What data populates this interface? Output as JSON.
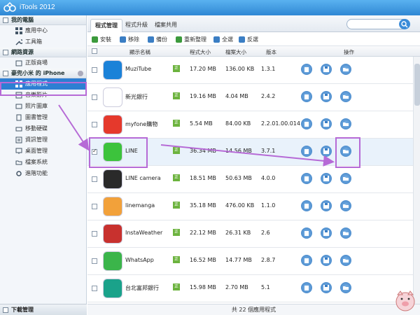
{
  "window": {
    "title": "iTools 2012"
  },
  "sidebar": {
    "sections": [
      {
        "label": "我的電腦",
        "items": [
          "應用中心",
          "工具箱"
        ]
      },
      {
        "label": "網路資源",
        "items": [
          "正版商場"
        ]
      },
      {
        "label": "豪兜小米 的 iPhone",
        "items": [
          "應用程式",
          "音樂影片",
          "照片圖庫",
          "圖書管理",
          "移動硬碟",
          "資訊管理",
          "桌面管理",
          "檔案系統",
          "進階功能"
        ]
      }
    ],
    "active_item": "應用程式",
    "download_label": "下載管理"
  },
  "tabs": [
    "程式管理",
    "程式升級",
    "檔案共用"
  ],
  "search": {
    "placeholder": ""
  },
  "toolbar": [
    "安裝",
    "移除",
    "備份",
    "重新整理",
    "全選",
    "反選"
  ],
  "table": {
    "columns": [
      "顯示名稱",
      "程式大小",
      "檔案大小",
      "版本",
      "操作"
    ],
    "rows": [
      {
        "name": "MuziTube",
        "format": "正",
        "app_size": "17.20 MB",
        "doc_size": "136.00 KB",
        "version": "1.3.1",
        "checked": false,
        "icon": "muzitube-icon",
        "icon_color": "#1b82d8"
      },
      {
        "name": "新光銀行",
        "format": "正",
        "app_size": "19.16 MB",
        "doc_size": "4.04 MB",
        "version": "2.4.2",
        "checked": false,
        "icon": "skbank-icon",
        "icon_color": "#ffffff"
      },
      {
        "name": "myfone購物",
        "format": "正",
        "app_size": "5.54 MB",
        "doc_size": "84.00 KB",
        "version": "2.2.01.00.014",
        "checked": false,
        "icon": "myfone-icon",
        "icon_color": "#e5392c"
      },
      {
        "name": "LINE",
        "format": "正",
        "app_size": "36.34 MB",
        "doc_size": "14.56 MB",
        "version": "3.7.1",
        "checked": true,
        "icon": "line-icon",
        "icon_color": "#3cc33c"
      },
      {
        "name": "LINE camera",
        "format": "正",
        "app_size": "18.51 MB",
        "doc_size": "50.63 MB",
        "version": "4.0.0",
        "checked": false,
        "icon": "line-camera-icon",
        "icon_color": "#2a2a2a"
      },
      {
        "name": "linemanga",
        "format": "正",
        "app_size": "35.18 MB",
        "doc_size": "476.00 KB",
        "version": "1.1.0",
        "checked": false,
        "icon": "linemanga-icon",
        "icon_color": "#f2a13a"
      },
      {
        "name": "InstaWeather",
        "format": "正",
        "app_size": "22.12 MB",
        "doc_size": "26.31 KB",
        "version": "2.6",
        "checked": false,
        "icon": "instaweather-icon",
        "icon_color": "#c8312e"
      },
      {
        "name": "WhatsApp",
        "format": "正",
        "app_size": "16.52 MB",
        "doc_size": "14.77 MB",
        "version": "2.8.7",
        "checked": false,
        "icon": "whatsapp-icon",
        "icon_color": "#3bb54a"
      },
      {
        "name": "台北富邦銀行",
        "format": "正",
        "app_size": "15.98 MB",
        "doc_size": "2.70 MB",
        "version": "5.1",
        "checked": false,
        "icon": "fubon-icon",
        "icon_color": "#1aa28a"
      }
    ],
    "selected_row": "LINE"
  },
  "footer": {
    "total": "共 22 個應用程式"
  },
  "colors": {
    "accent": "#2d7fd3",
    "annotation": "#b66ad6"
  }
}
